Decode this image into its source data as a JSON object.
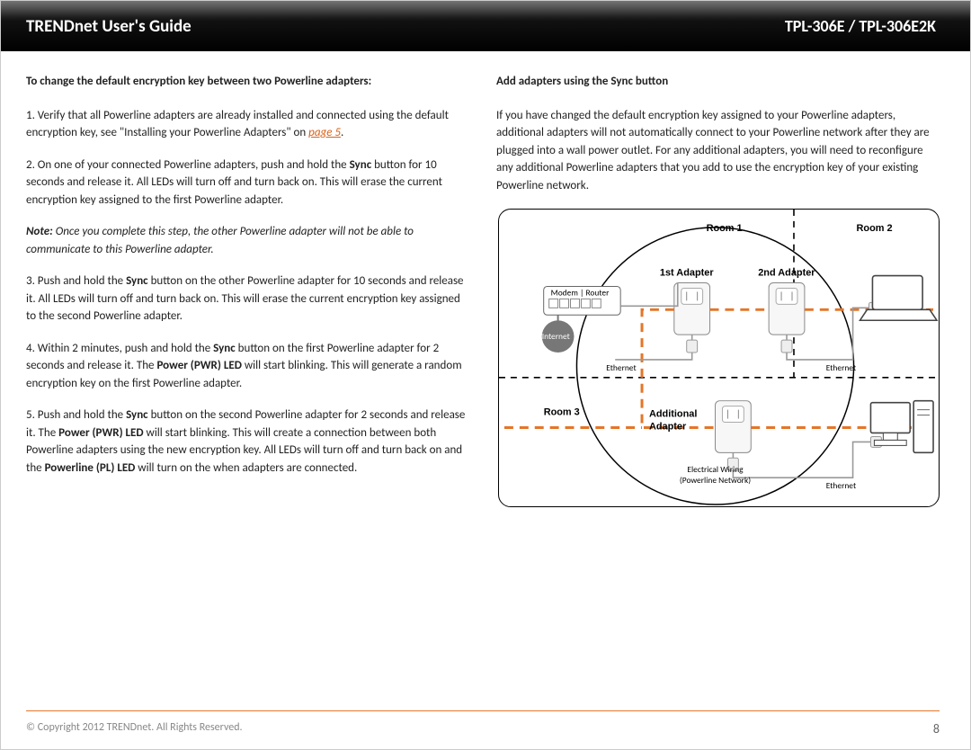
{
  "header": {
    "title": "TRENDnet User's Guide",
    "model": "TPL-306E / TPL-306E2K"
  },
  "left": {
    "heading": "To change the default encryption key between two Powerline adapters:",
    "p1a": "1. Verify that all Powerline adapters are already installed and connected using the default encryption key, see \"Installing your Powerline Adapters\" on ",
    "p1link": "page 5",
    "p1b": ".",
    "p2a": "2. On one of your connected Powerline adapters, push and hold the ",
    "sync": "Sync",
    "p2b": " button for 10 seconds and release it. All LEDs will turn off and turn back on. This will erase the current encryption key assigned to the first Powerline adapter.",
    "noteLabel": "Note:",
    "noteBody": " Once you complete this step, the other Powerline adapter will not be able to communicate to this Powerline adapter.",
    "p3a": "3. Push and hold the ",
    "p3b": " button on the other Powerline adapter for 10 seconds and release it. All LEDs will turn off and turn back on. This will erase the current encryption key assigned to the second Powerline adapter.",
    "p4a": "4. Within 2 minutes, push and hold the ",
    "p4b": " button on the first Powerline adapter for 2 seconds and release it. The ",
    "pwrLed": "Power (PWR) LED",
    "p4c": " will start blinking. This will generate a random encryption key on the first Powerline adapter.",
    "p5a": "5. Push and hold the ",
    "p5b": " button on the second Powerline adapter for 2 seconds and release it. The ",
    "p5c": " will start blinking. This will create a connection between both Powerline adapters using the new encryption key. All LEDs will turn off and turn back on and the ",
    "plLed": "Powerline (PL) LED",
    "p5d": " will turn on the when adapters are connected."
  },
  "right": {
    "heading": "Add adapters using the Sync button",
    "p1": "If you have changed the default encryption key assigned to your Powerline adapters, additional adapters will not automatically connect to your Powerline network after they are plugged into a wall power outlet. For any additional adapters, you will need to reconfigure any additional Powerline adapters that you add to use the encryption key of your existing Powerline network."
  },
  "diagram": {
    "room1": "Room 1",
    "room2": "Room 2",
    "room3": "Room 3",
    "a1": "1st Adapter",
    "a2": "2nd Adapter",
    "addl1": "Additional",
    "addl2": "Adapter",
    "modem": "Modem | Router",
    "internet": "Internet",
    "eth": "Ethernet",
    "wiring1": "Electrical Wiring",
    "wiring2": "(Powerline Network)"
  },
  "footer": {
    "copyright": "© Copyright 2012 TRENDnet. All Rights Reserved.",
    "page": "8"
  }
}
